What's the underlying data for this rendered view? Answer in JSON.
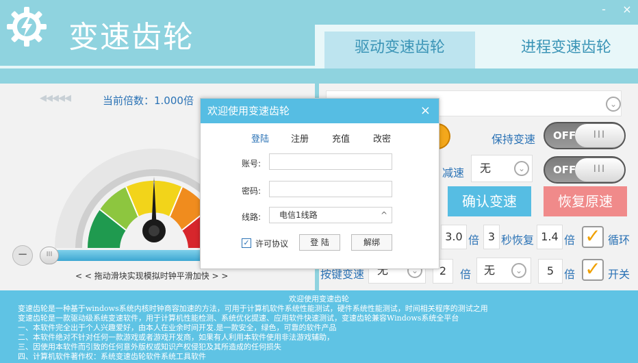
{
  "app": {
    "title": "变速齿轮",
    "minimize": "-",
    "close": "×"
  },
  "tabs": [
    "驱动变速齿轮",
    "进程变速齿轮"
  ],
  "left": {
    "arrows": "◀◀◀◀◀",
    "rate_label": "当前倍数：1.000倍",
    "minus": "−",
    "slider_thumb": "III",
    "slider_hint": "< < 拖动滑块实现模拟时钟平滑加快 > >"
  },
  "right": {
    "keep_speed": "保持变速",
    "slow": "减速",
    "slow_value": "无",
    "toggle_off": "OFF",
    "toggle_knob": "III",
    "confirm": "确认变速",
    "restore": "恢复原速",
    "row1": {
      "value1": "3.0",
      "unit1": "倍",
      "value2": "3",
      "label2": "秒恢复",
      "value3": "1.4",
      "unit3": "倍",
      "check_label": "循环"
    },
    "row2": {
      "hotkey_label": "按键变速",
      "hotkey_value": "无",
      "value1": "2",
      "unit1": "倍",
      "value2": "无",
      "value3": "5",
      "unit3": "倍",
      "check_label": "开关"
    }
  },
  "info": {
    "heading": "欢迎使用变速齿轮",
    "lines": [
      "变速齿轮是一种基于windows系统内核时钟商容加速的方法，可用于计算机软件系统性能测试，硬件系统性能测试，时间相关程序的测试之用",
      "变速齿轮是一款驱动级系统变速软件，用于计算机性能检测、系统优化提速、应用软件快速测试，变速齿轮兼容Windows系统全平台",
      "一、本软件完全出于个人兴趣爱好，由本人在业余时间开发.是一款安全，绿色，可靠的软件产品",
      "二、本软件绝对不针对任何一款游戏或者游戏开发商，如果有人利用本软件使用非法游戏辅助，",
      "三、因使用本软件而引致的任何意外版权或知识产权侵犯及其所造成的任何损失",
      "四、计算机软件著作权：系统变速齿轮软件系统工具软件"
    ]
  },
  "dialog": {
    "title": "欢迎使用变速齿轮",
    "close": "×",
    "tabs": [
      "登陆",
      "注册",
      "充值",
      "改密"
    ],
    "account_label": "账号:",
    "password_label": "密码:",
    "route_label": "线路:",
    "route_value": "电信1线路",
    "route_arrow": "^",
    "agree_label": "许可协议",
    "check_mark": "✓",
    "login_button": "登 陆",
    "unbind_button": "解绑"
  }
}
